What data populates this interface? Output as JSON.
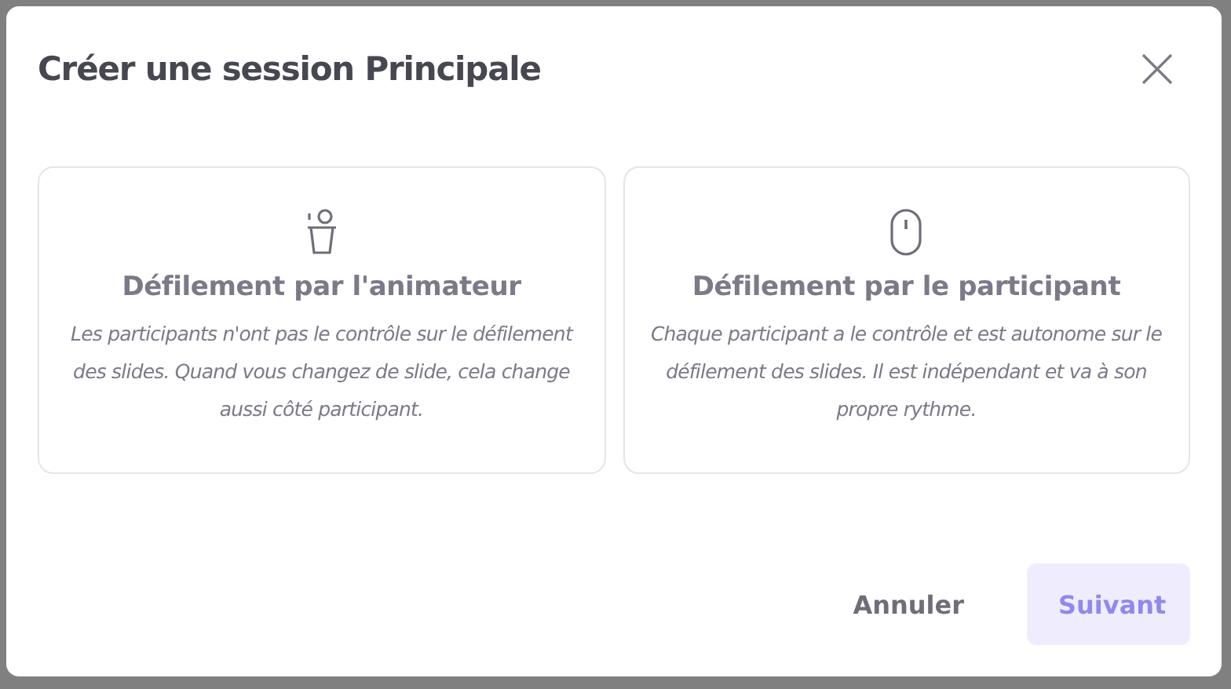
{
  "dialog": {
    "title": "Créer une session Principale",
    "options": [
      {
        "kind": "presenter",
        "title": "Défilement par l'animateur",
        "description": "Les participants n'ont pas le contrôle sur le défilement des slides. Quand vous changez de slide, cela change aussi côté participant.",
        "selected": false
      },
      {
        "kind": "mouse",
        "title": "Défilement par le participant",
        "description": "Chaque participant a le contrôle et est autonome sur le défilement des slides. Il est indépendant et va à son propre rythme.",
        "selected": false
      }
    ],
    "buttons": [
      {
        "label": "Annuler",
        "kind": "text",
        "disabled": false
      },
      {
        "label": "Suivant",
        "kind": "primary",
        "disabled": true
      }
    ]
  }
}
